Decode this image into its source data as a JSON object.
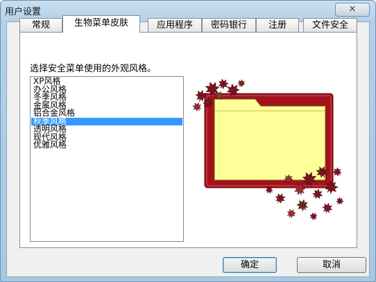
{
  "window": {
    "title": "用户设置",
    "close_glyph": "✕"
  },
  "tabs": [
    {
      "label": "常规",
      "active": false
    },
    {
      "label": "生物菜单皮肤",
      "active": true
    },
    {
      "label": "应用程序",
      "active": false
    },
    {
      "label": "密码银行",
      "active": false
    },
    {
      "label": "注册",
      "active": false
    },
    {
      "label": "文件安全",
      "active": false
    }
  ],
  "panel": {
    "instruction": "选择安全菜单使用的外观风格。",
    "styles": [
      "XP风格",
      "办公风格",
      "冬季风格",
      "金属风格",
      "铝合金风格",
      "秋季风格",
      "透明风格",
      "现代风格",
      "优雅风格"
    ],
    "selected_style": "秋季风格",
    "preview_icon": "autumn-folder-icon"
  },
  "buttons": {
    "ok": "确定",
    "cancel": "取消"
  },
  "colors": {
    "selection": "#3399ff",
    "folder_frame": "#a3121b",
    "folder_fill": "#ffff99",
    "leaf": "#7a1420"
  }
}
